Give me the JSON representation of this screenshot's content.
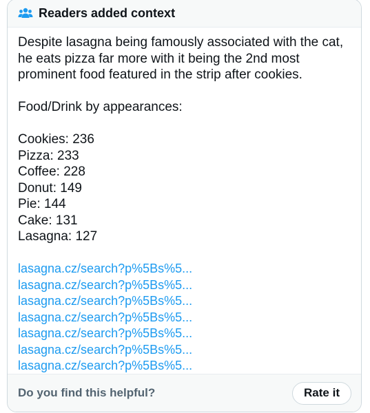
{
  "header": {
    "icon": "people-group-icon",
    "icon_color": "#1d9bf0",
    "title": "Readers added context"
  },
  "note": {
    "text": "Despite lasagna being famously associated with the cat, he eats pizza far more with it being the 2nd most prominent food featured in the strip after cookies.",
    "list_heading": "Food/Drink by appearances:",
    "items": [
      "Cookies: 236",
      "Pizza: 233",
      "Coffee: 228",
      "Donut: 149",
      "Pie: 144",
      "Cake: 131",
      "Lasagna: 127"
    ],
    "links": [
      "lasagna.cz/search?p%5Bs%5...",
      "lasagna.cz/search?p%5Bs%5...",
      "lasagna.cz/search?p%5Bs%5...",
      "lasagna.cz/search?p%5Bs%5...",
      "lasagna.cz/search?p%5Bs%5...",
      "lasagna.cz/search?p%5Bs%5...",
      "lasagna.cz/search?p%5Bs%5..."
    ],
    "link_color": "#1d9bf0"
  },
  "footer": {
    "question": "Do you find this helpful?",
    "rate_label": "Rate it"
  }
}
